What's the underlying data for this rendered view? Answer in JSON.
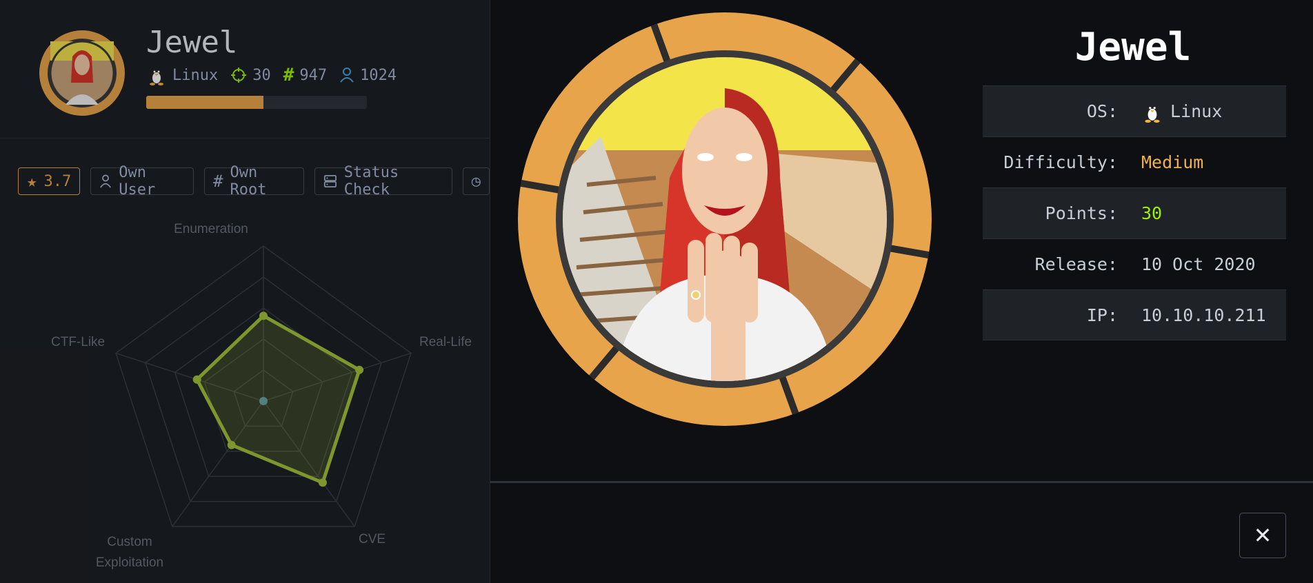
{
  "machine": {
    "name": "Jewel",
    "os": "Linux",
    "points": "30",
    "user_owns": "947",
    "system_owns": "1024",
    "progress_fraction": 0.53
  },
  "actions": {
    "rating": "3.7",
    "own_user": "Own User",
    "own_root": "Own Root",
    "status_check": "Status Check"
  },
  "radar": {
    "axes": [
      "Enumeration",
      "Real-Life",
      "CVE",
      "Custom Exploitation",
      "CTF-Like"
    ],
    "values": [
      0.55,
      0.65,
      0.65,
      0.35,
      0.45
    ]
  },
  "details": {
    "title": "Jewel",
    "rows": [
      {
        "label": "OS:",
        "value": "Linux"
      },
      {
        "label": "Difficulty:",
        "value": "Medium"
      },
      {
        "label": "Points:",
        "value": "30"
      },
      {
        "label": "Release:",
        "value": "10 Oct 2020"
      },
      {
        "label": "IP:",
        "value": "10.10.10.211"
      }
    ]
  },
  "close_label": "✕",
  "colors": {
    "accent_orange": "#e8a44a",
    "accent_green": "#9fef00",
    "radar_green": "#a2c13b",
    "user_blue": "#4ea3d8"
  }
}
